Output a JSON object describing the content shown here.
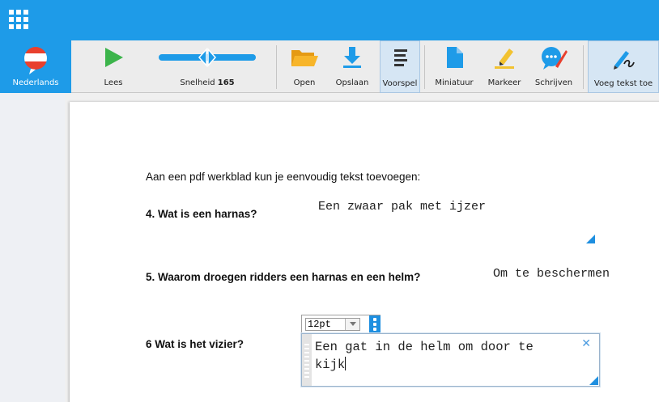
{
  "toolbar": {
    "language": "Nederlands",
    "read": "Lees",
    "speed_label": "Snelheid",
    "speed_value": "165",
    "open": "Open",
    "save": "Opslaan",
    "preview": "Voorspel",
    "thumbnail": "Miniatuur",
    "highlight": "Markeer",
    "write": "Schrijven",
    "add_text": "Voeg tekst toe"
  },
  "document": {
    "intro": "Aan een pdf werkblad kun je eenvoudig tekst toevoegen:",
    "q4": "4. Wat is een harnas?",
    "a4": "Een zwaar pak met ijzer",
    "q5": "5. Waarom droegen ridders een harnas en een helm?",
    "a5": "Om te beschermen",
    "q6": "6 Wat is het vizier?"
  },
  "editor": {
    "font_size": "12pt",
    "text_line1": "Een gat in de helm om door te",
    "text_line2": "kijk"
  },
  "colors": {
    "accent": "#1e9be8",
    "play": "#3cb44b",
    "folder": "#f7b52a",
    "highlighter": "#f2c230"
  },
  "icons": [
    "grid-icon",
    "flag-icon",
    "play-icon",
    "speed-slider",
    "folder-icon",
    "download-icon",
    "lines-icon",
    "page-icon",
    "highlighter-icon",
    "speech-pen-icon",
    "pen-text-icon",
    "close-x-icon"
  ]
}
